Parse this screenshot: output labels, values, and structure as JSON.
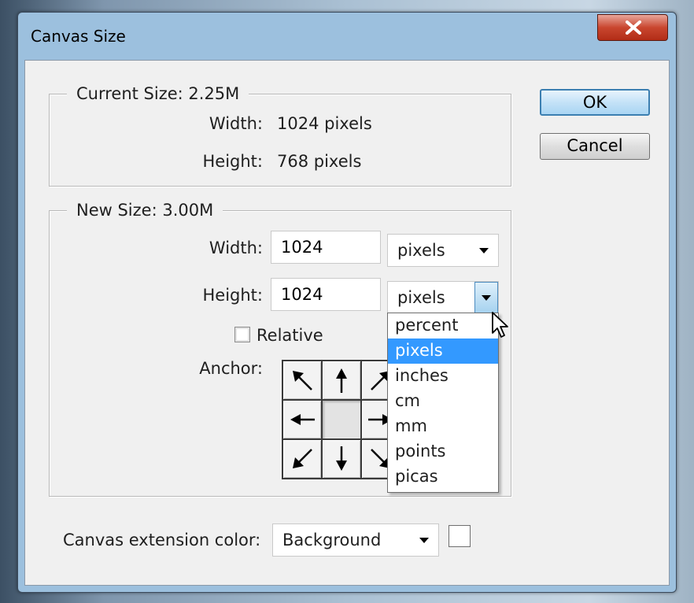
{
  "window": {
    "title": "Canvas Size"
  },
  "current_size": {
    "title": "Current Size: 2.25M",
    "width_label": "Width:",
    "width_value": "1024 pixels",
    "height_label": "Height:",
    "height_value": "768 pixels"
  },
  "new_size": {
    "title": "New Size: 3.00M",
    "width_label": "Width:",
    "width_value": "1024",
    "width_unit": "pixels",
    "height_label": "Height:",
    "height_value": "1024",
    "height_unit": "pixels",
    "relative_label": "Relative",
    "relative_checked": false,
    "anchor_label": "Anchor:"
  },
  "unit_dropdown": {
    "options": [
      "percent",
      "pixels",
      "inches",
      "cm",
      "mm",
      "points",
      "picas"
    ],
    "selected": "pixels"
  },
  "extension": {
    "label": "Canvas extension color:",
    "value": "Background",
    "swatch_color": "#ffffff"
  },
  "buttons": {
    "ok": "OK",
    "cancel": "Cancel"
  },
  "icons": {
    "close": "close-icon",
    "anchor_arrows": [
      "arrow-up-left-icon",
      "arrow-up-icon",
      "arrow-up-right-icon",
      "arrow-left-icon",
      "anchor-center",
      "arrow-right-icon",
      "arrow-down-left-icon",
      "arrow-down-icon",
      "arrow-down-right-icon"
    ]
  }
}
